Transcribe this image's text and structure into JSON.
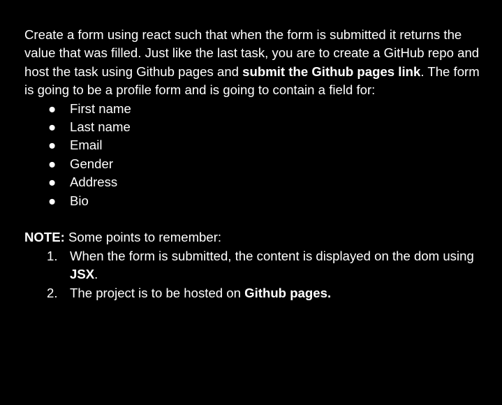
{
  "intro": {
    "part1": "Create a form using react such that when the form is submitted it returns the value that was filled. Just like the last task, you are to create a GitHub repo and host the task using Github pages and ",
    "bold1": "submit the Github pages link",
    "part2": ". The form is going to be a profile form and is going to contain a field for:"
  },
  "bullet_symbol": "●",
  "fields": [
    "First name",
    "Last name",
    "Email",
    "Gender",
    "Address",
    "Bio"
  ],
  "note": {
    "label": "NOTE:",
    "text": " Some points to remember:",
    "items": [
      {
        "num": "1.",
        "text": "When the form is submitted, the content is displayed on the dom using ",
        "bold": "JSX",
        "suffix": "."
      },
      {
        "num": "2.",
        "text": "The project is to be hosted on ",
        "bold": "Github pages.",
        "suffix": ""
      }
    ]
  }
}
